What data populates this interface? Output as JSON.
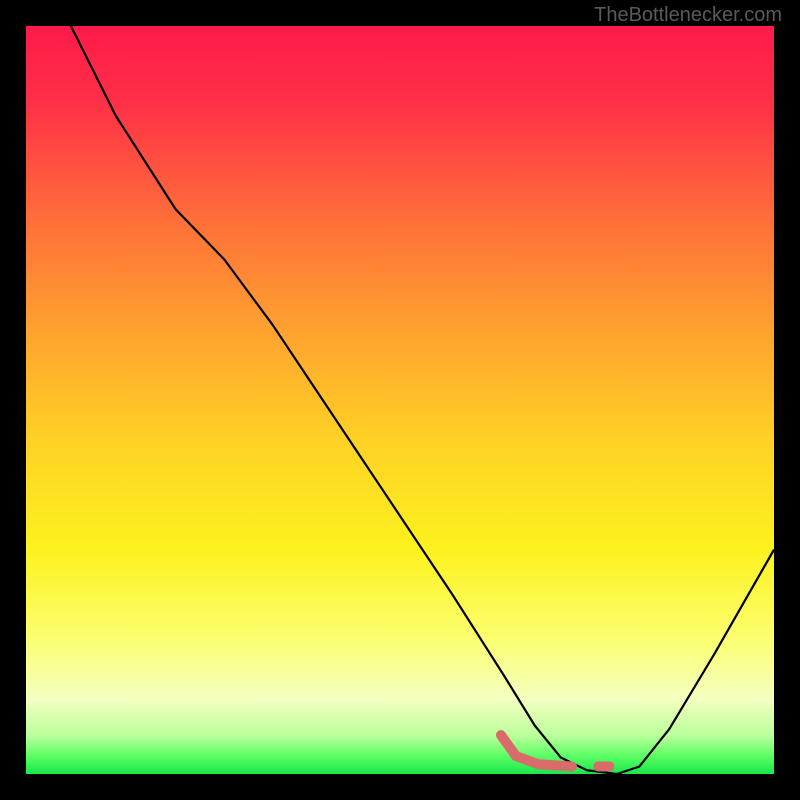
{
  "watermark": "TheBottlenecker.com",
  "chart_data": {
    "type": "line",
    "title": "",
    "xlabel": "",
    "ylabel": "",
    "xlim": [
      0,
      100
    ],
    "ylim": [
      0,
      100
    ],
    "gradient_stops": [
      {
        "pos": 0.0,
        "color": "#ff1a4a"
      },
      {
        "pos": 0.1,
        "color": "#ff2f47"
      },
      {
        "pos": 0.25,
        "color": "#ff6b3a"
      },
      {
        "pos": 0.4,
        "color": "#ffa030"
      },
      {
        "pos": 0.55,
        "color": "#ffd025"
      },
      {
        "pos": 0.7,
        "color": "#fdf21e"
      },
      {
        "pos": 0.82,
        "color": "#fbff70"
      },
      {
        "pos": 0.9,
        "color": "#f4ffc0"
      },
      {
        "pos": 0.95,
        "color": "#b8ff9a"
      },
      {
        "pos": 0.975,
        "color": "#5fff66"
      },
      {
        "pos": 1.0,
        "color": "#16e84a"
      }
    ],
    "series": [
      {
        "name": "bottleneck-curve",
        "stroke": "#000000",
        "width": 2.2,
        "points": [
          {
            "x": 6.0,
            "y": 100.0
          },
          {
            "x": 12.0,
            "y": 88.0
          },
          {
            "x": 20.0,
            "y": 75.5
          },
          {
            "x": 26.5,
            "y": 68.8
          },
          {
            "x": 33.0,
            "y": 60.0
          },
          {
            "x": 45.0,
            "y": 42.0
          },
          {
            "x": 57.0,
            "y": 24.0
          },
          {
            "x": 64.0,
            "y": 13.0
          },
          {
            "x": 68.0,
            "y": 6.5
          },
          {
            "x": 71.5,
            "y": 2.2
          },
          {
            "x": 75.0,
            "y": 0.5
          },
          {
            "x": 79.0,
            "y": 0.0
          },
          {
            "x": 82.0,
            "y": 1.0
          },
          {
            "x": 86.0,
            "y": 6.0
          },
          {
            "x": 92.0,
            "y": 16.0
          },
          {
            "x": 100.0,
            "y": 30.0
          }
        ]
      },
      {
        "name": "highlight-segment",
        "stroke": "#d96b6b",
        "width": 10,
        "linecap": "round",
        "points": [
          {
            "x": 63.5,
            "y": 5.2
          },
          {
            "x": 65.5,
            "y": 2.4
          },
          {
            "x": 68.5,
            "y": 1.3
          },
          {
            "x": 73.0,
            "y": 1.0
          }
        ]
      },
      {
        "name": "highlight-dot",
        "stroke": "#d96b6b",
        "width": 10,
        "linecap": "round",
        "points": [
          {
            "x": 76.5,
            "y": 1.0
          },
          {
            "x": 78.0,
            "y": 1.0
          }
        ]
      }
    ]
  }
}
